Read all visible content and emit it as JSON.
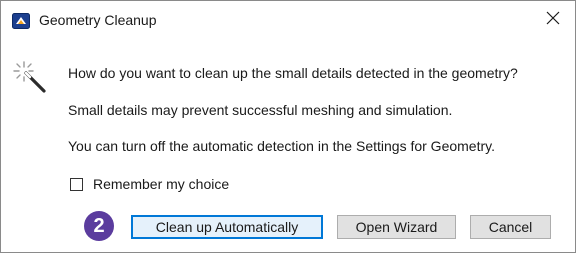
{
  "window": {
    "title": "Geometry Cleanup",
    "close_glyph": "✕",
    "app_icon": "app-logo-icon"
  },
  "message": {
    "icon": "magic-wand-icon",
    "line1": "How do you want to clean up the small details detected in the geometry?",
    "line2": "Small details may prevent successful meshing and simulation.",
    "line3": "You can turn off the automatic detection in the Settings for Geometry."
  },
  "remember": {
    "label": "Remember my choice",
    "checked": false
  },
  "step_badge": "2",
  "buttons": {
    "clean_up": "Clean up Automatically",
    "open_wizard": "Open Wizard",
    "cancel": "Cancel"
  },
  "colors": {
    "badge": "#5b3c9e",
    "primary_border": "#0078d7",
    "primary_fill": "#e5f1fb"
  }
}
